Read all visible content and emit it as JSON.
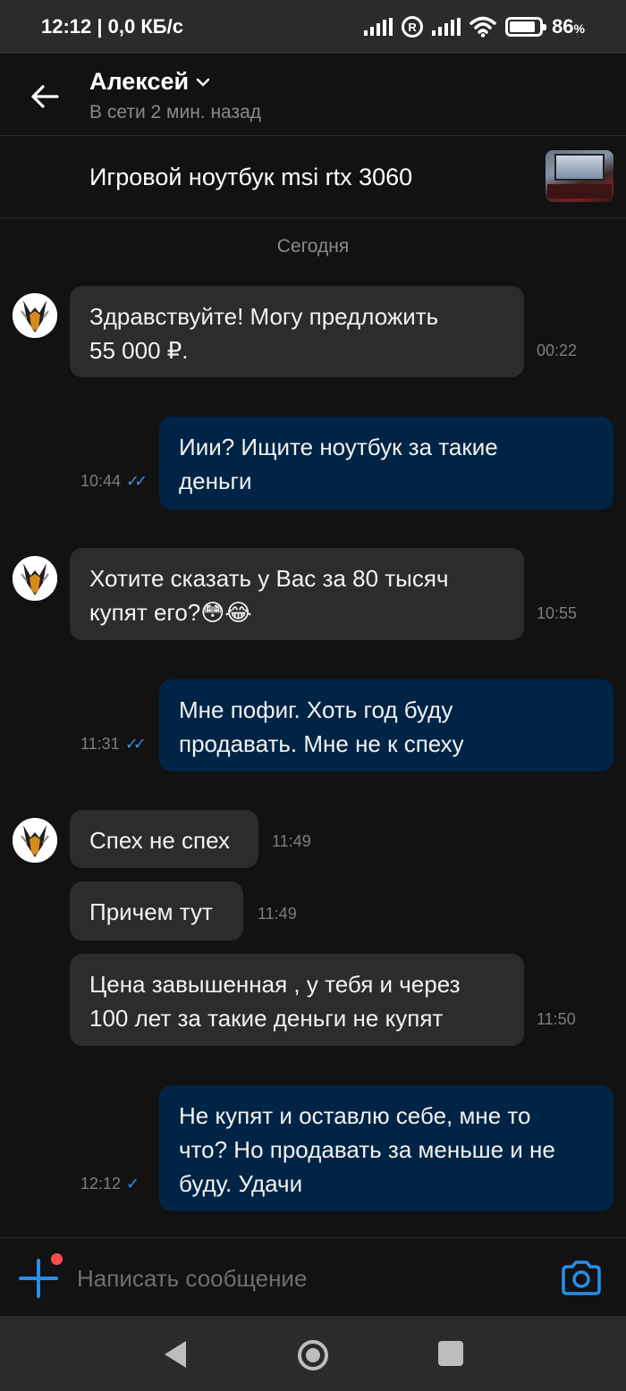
{
  "status_bar": {
    "time_speed": "12:12 | 0,0 КБ/с",
    "reg_icon_text": "R",
    "battery_pct": "86",
    "battery_unit": "%",
    "battery_level": 0.86
  },
  "header": {
    "name": "Алексей",
    "status": "В сети 2 мин. назад"
  },
  "listing": {
    "title": "Игровой ноутбук msi rtx 3060"
  },
  "date_separator": "Сегодня",
  "messages": [
    {
      "direction": "in",
      "text": "Здравствуйте! Могу предложить\n55 000 ₽.",
      "time": "00:22"
    },
    {
      "direction": "out",
      "text": "Иии? Ищите ноутбук за такие\nденьги",
      "time": "10:44",
      "read": true
    },
    {
      "direction": "in",
      "text": "Хотите сказать у Вас за 80 тысяч\nкупят его?😳😂",
      "time": "10:55"
    },
    {
      "direction": "out",
      "text": "Мне пофиг. Хоть год буду\nпродавать. Мне не к спеху",
      "time": "11:31",
      "read": true
    },
    {
      "direction": "in",
      "text": "Спех не спех",
      "time": "11:49"
    },
    {
      "direction": "in",
      "text": "Причем тут",
      "time": "11:49"
    },
    {
      "direction": "in",
      "text": "Цена завышенная , у тебя и через\n100 лет за такие деньги не купят",
      "time": "11:50"
    },
    {
      "direction": "out",
      "text": "Не купят и оставлю себе, мне то\nчто? Но продавать за меньше и не\nбуду. Удачи",
      "time": "12:12",
      "read": false
    }
  ],
  "input": {
    "placeholder": "Написать сообщение",
    "value": ""
  },
  "colors": {
    "accent": "#2a8ee8",
    "incoming_bubble": "#2c2c2c",
    "outgoing_bubble": "#002445",
    "notification_dot": "#ff4d4f"
  },
  "icons": {
    "back": "arrow-left-icon",
    "dropdown": "chevron-down-icon",
    "attach": "plus-icon",
    "camera": "camera-icon",
    "read_receipt": "double-check-icon",
    "sent_receipt": "check-icon"
  }
}
